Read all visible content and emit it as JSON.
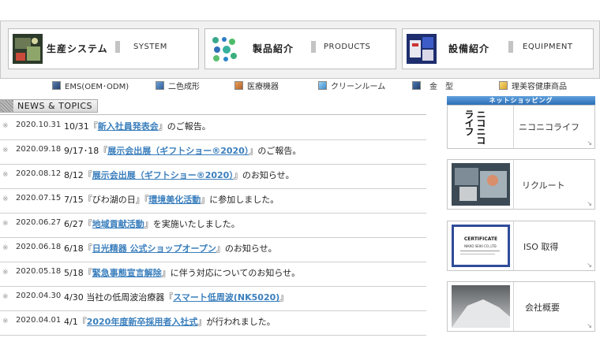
{
  "nav": {
    "system": {
      "ja": "生産システム",
      "en": "SYSTEM"
    },
    "products": {
      "ja": "製品紹介",
      "en": "PRODUCTS"
    },
    "equipment": {
      "ja": "設備紹介",
      "en": "EQUIPMENT"
    }
  },
  "categories": [
    {
      "label": "EMS(OEM･ODM)",
      "color": "#2e5a96"
    },
    {
      "label": "二色成形",
      "color": "#2e6fb0"
    },
    {
      "label": "医療機器",
      "color": "#c0702f"
    },
    {
      "label": "クリーンルーム",
      "color": "#4a9ad8"
    },
    {
      "label": "金　型",
      "color": "#264a80"
    },
    {
      "label": "理美容健康商品",
      "color": "#e1ae35"
    }
  ],
  "news": {
    "title": "NEWS & TOPICS",
    "bullet": "※",
    "items": [
      {
        "date": "2020.10.31",
        "pre": "10/31『",
        "link": "新入社員発表会",
        "post": "』のご報告。"
      },
      {
        "date": "2020.09.18",
        "pre": "9/17･18『",
        "link": "展示会出展（ギフトショー®2020）",
        "post": "』のご報告。"
      },
      {
        "date": "2020.08.12",
        "pre": "8/12『",
        "link": "展示会出展（ギフトショー®2020）",
        "post": "』のお知らせ。"
      },
      {
        "date": "2020.07.15",
        "pre": "7/15『びわ湖の日』『",
        "link": "環境美化活動",
        "post": "』に参加しました。"
      },
      {
        "date": "2020.06.27",
        "pre": "6/27『",
        "link": "地域貢献活動",
        "post": "』を実施いたしました。"
      },
      {
        "date": "2020.06.18",
        "pre": "6/18『",
        "link": "日光精器 公式ショップオープン",
        "post": "』のお知らせ。"
      },
      {
        "date": "2020.05.18",
        "pre": "5/18『",
        "link": "緊急事態宣言解除",
        "post": "』に伴う対応についてのお知らせ。"
      },
      {
        "date": "2020.04.30",
        "pre": "4/30 当社の低周波治療器『",
        "link": "スマート低周波(NK5020)",
        "post": "』"
      },
      {
        "date": "2020.04.01",
        "pre": "4/1『",
        "link": "2020年度新卒採用者入社式",
        "post": "』が行われました。"
      }
    ]
  },
  "sidebar": {
    "shop_header": "ネットショッピング",
    "shop_logo": "ニコニコライフ",
    "shop_label": "ニコニコライフ",
    "recruit_label": "リクルート",
    "iso_label": "ISO 取得",
    "iso_cert_title": "CERTIFICATE",
    "iso_cert_company": "NIKKO SEIKI CO.,LTD.",
    "company_label": "会社概要",
    "arrow": "↘"
  }
}
